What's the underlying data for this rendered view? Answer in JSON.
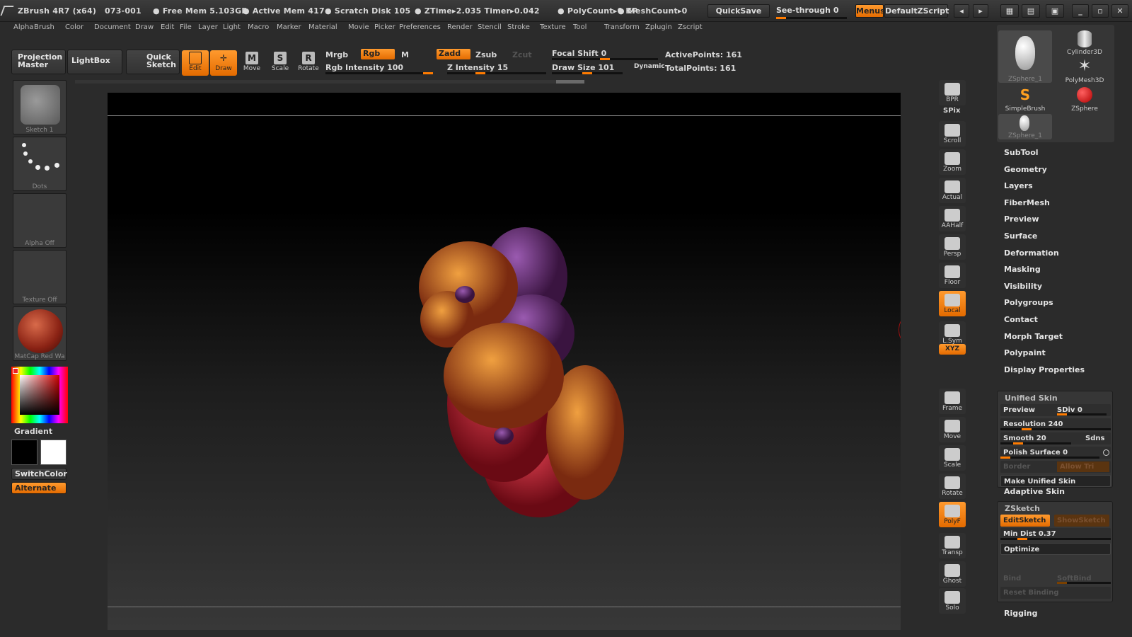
{
  "title": {
    "app": "ZBrush 4R7 (x64)",
    "build": "073-001",
    "free_mem": "● Free Mem 5.103GB",
    "active_mem": "● Active Mem 417",
    "scratch": "● Scratch Disk 105",
    "ztime": "● ZTime▸2.035 Timer▸0.042",
    "polycount": "● PolyCount▸0 KP",
    "meshcount": "● MeshCount▸0",
    "quicksave": "QuickSave",
    "seethrough": "See-through  0",
    "menus": "Menus",
    "zscript": "DefaultZScript"
  },
  "menu": [
    "Alpha",
    "Brush",
    "Color",
    "Document",
    "Draw",
    "Edit",
    "File",
    "Layer",
    "Light",
    "Macro",
    "Marker",
    "Material",
    "Movie",
    "Picker",
    "Preferences",
    "Render",
    "Stencil",
    "Stroke",
    "Texture",
    "Tool",
    "Transform",
    "Zplugin",
    "Zscript"
  ],
  "toolbar": {
    "projection": "Projection\nMaster",
    "lightbox": "LightBox",
    "quick": "Quick\nSketch",
    "edit": "Edit",
    "draw": "Draw",
    "move": "Move",
    "scale": "Scale",
    "rotate": "Rotate",
    "mrgb": "Mrgb",
    "rgb": "Rgb",
    "m": "M",
    "zadd": "Zadd",
    "zsub": "Zsub",
    "zcut": "Zcut",
    "rgb_int": "Rgb Intensity 100",
    "z_int": "Z Intensity 15",
    "focal": "Focal Shift 0",
    "drawsize": "Draw Size 101",
    "dynamic": "Dynamic",
    "active": "ActivePoints: 161",
    "total": "TotalPoints: 161"
  },
  "left": {
    "sketch": "Sketch 1",
    "dots": "Dots",
    "alpha": "Alpha Off",
    "texture": "Texture Off",
    "matcap": "MatCap Red Wa",
    "gradient": "Gradient",
    "switch": "SwitchColor",
    "alternate": "Alternate"
  },
  "shelf": [
    "BPR",
    "SPix",
    "Scroll",
    "Zoom",
    "Actual",
    "AAHalf",
    "Persp",
    "Floor",
    "Local",
    "L.Sym",
    "XYZ",
    "Frame",
    "Move",
    "Scale",
    "Rotate",
    "PolyF",
    "Transp",
    "Ghost",
    "Solo"
  ],
  "tools": [
    "ZSphere_1",
    "Cylinder3D",
    "SimpleBrush",
    "PolyMesh3D",
    "ZSphere",
    "ZSphere_1"
  ],
  "panel": [
    "SubTool",
    "Geometry",
    "Layers",
    "FiberMesh",
    "Preview",
    "Surface",
    "Deformation",
    "Masking",
    "Visibility",
    "Polygroups",
    "Contact",
    "Morph Target",
    "Polypaint",
    "Display Properties"
  ],
  "unified": {
    "hdr": "Unified Skin",
    "preview": "Preview",
    "sdiv": "SDiv 0",
    "res": "Resolution 240",
    "smooth": "Smooth 20",
    "sdns": "Sdns",
    "polish": "Polish Surface 0",
    "border": "Border",
    "allow": "Allow Tri",
    "make": "Make Unified Skin"
  },
  "adaptive": "Adaptive Skin",
  "zsketch": {
    "hdr": "ZSketch",
    "edit": "EditSketch",
    "show": "ShowSketch",
    "min": "Min Dist 0.37",
    "opt": "Optimize",
    "bind": "Bind",
    "soft": "SoftBind",
    "reset": "Reset Binding"
  },
  "rigging": "Rigging"
}
